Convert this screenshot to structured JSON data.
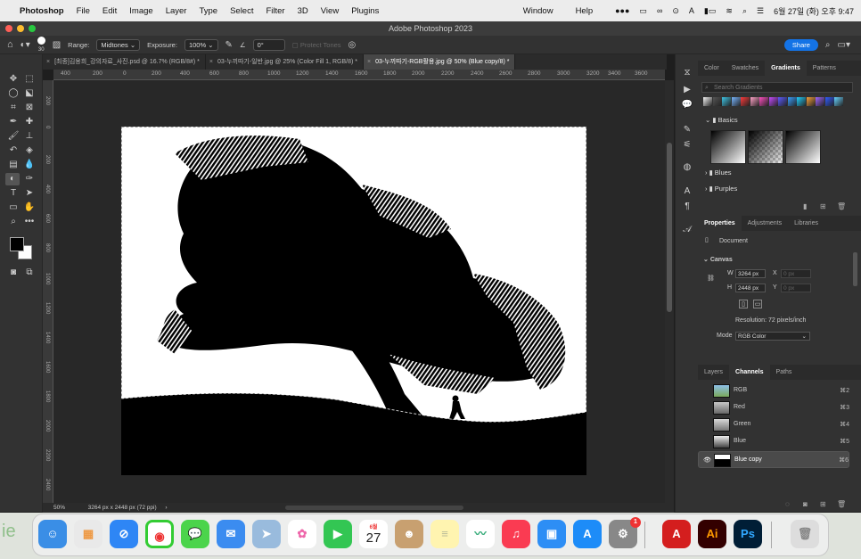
{
  "menubar": {
    "app": "Photoshop",
    "items": [
      "File",
      "Edit",
      "Image",
      "Layer",
      "Type",
      "Select",
      "Filter",
      "3D",
      "View",
      "Plugins"
    ],
    "right_items": [
      "Window",
      "Help"
    ],
    "clock": "6월 27일 (화) 오후 9:47"
  },
  "window": {
    "title": "Adobe Photoshop 2023"
  },
  "options": {
    "brush_size": "30",
    "range_label": "Range:",
    "range_value": "Midtones",
    "exposure_label": "Exposure:",
    "exposure_value": "100%",
    "angle_value": "0°",
    "protect_tones": "Protect Tones",
    "share": "Share"
  },
  "tabs": [
    {
      "label": "[최종]김용희_강의자료_사진.psd @ 16.7% (RGB/8#) *"
    },
    {
      "label": "03-누끼따기-일반.jpg @ 25% (Color Fill 1, RGB/8) *"
    },
    {
      "label": "03-누끼따기-RGB활용.jpg @ 50% (Blue copy/8) *"
    }
  ],
  "ruler": {
    "h": [
      "400",
      "200",
      "0",
      "200",
      "400",
      "600",
      "800",
      "1000",
      "1200",
      "1400",
      "1600",
      "1800",
      "2000",
      "2200",
      "2400",
      "2600",
      "2800",
      "3000",
      "3200",
      "3400",
      "3600"
    ],
    "v": [
      "2 0 0",
      "0",
      "2 0 0",
      "4 0 0",
      "6 0 0",
      "8 0 0",
      "1 0 0 0",
      "1 2 0 0",
      "1 4 0 0",
      "1 6 0 0",
      "1 8 0 0",
      "2 0 0 0",
      "2 2 0 0",
      "2 4 0 0"
    ]
  },
  "status": {
    "zoom": "50%",
    "doc_size": "3264 px x 2448 px (72 ppi)"
  },
  "gradients_panel": {
    "tabs": [
      "Color",
      "Swatches",
      "Gradients",
      "Patterns"
    ],
    "search_placeholder": "Search Gradients",
    "folders": [
      "Basics",
      "Blues",
      "Purples"
    ],
    "colors": {
      "swatch_colors": [
        "#f5f5f5",
        "#555555",
        "#3ec7e8",
        "#79b6ff",
        "#ff3b3b",
        "#ffa2c7",
        "#ff4fc1",
        "#c64bff",
        "#5c5cff",
        "#39a0ff",
        "#1fd1ff",
        "#f6a13c",
        "#9f66ff",
        "#2f5cff",
        "#67d4ff"
      ]
    }
  },
  "properties_panel": {
    "tabs": [
      "Properties",
      "Adjustments",
      "Libraries"
    ],
    "document": "Document",
    "canvas": "Canvas",
    "w_label": "W",
    "w_value": "3264 px",
    "h_label": "H",
    "h_value": "2448 px",
    "x_label": "X",
    "x_value": "0 px",
    "y_label": "Y",
    "y_value": "0 px",
    "resolution": "Resolution: 72 pixels/inch",
    "mode_label": "Mode",
    "mode_value": "RGB Color"
  },
  "channels_panel": {
    "tabs": [
      "Layers",
      "Channels",
      "Paths"
    ],
    "channels": [
      {
        "name": "RGB",
        "key": "⌘2"
      },
      {
        "name": "Red",
        "key": "⌘3"
      },
      {
        "name": "Green",
        "key": "⌘4"
      },
      {
        "name": "Blue",
        "key": "⌘5"
      },
      {
        "name": "Blue copy",
        "key": "⌘6"
      }
    ]
  },
  "dock": {
    "calendar_month": "6월",
    "calendar_day": "27",
    "settings_badge": "1",
    "acrobat_glyph": "A",
    "illustrator_glyph": "Ai",
    "photoshop_glyph": "Ps",
    "bg_text": "ie"
  }
}
